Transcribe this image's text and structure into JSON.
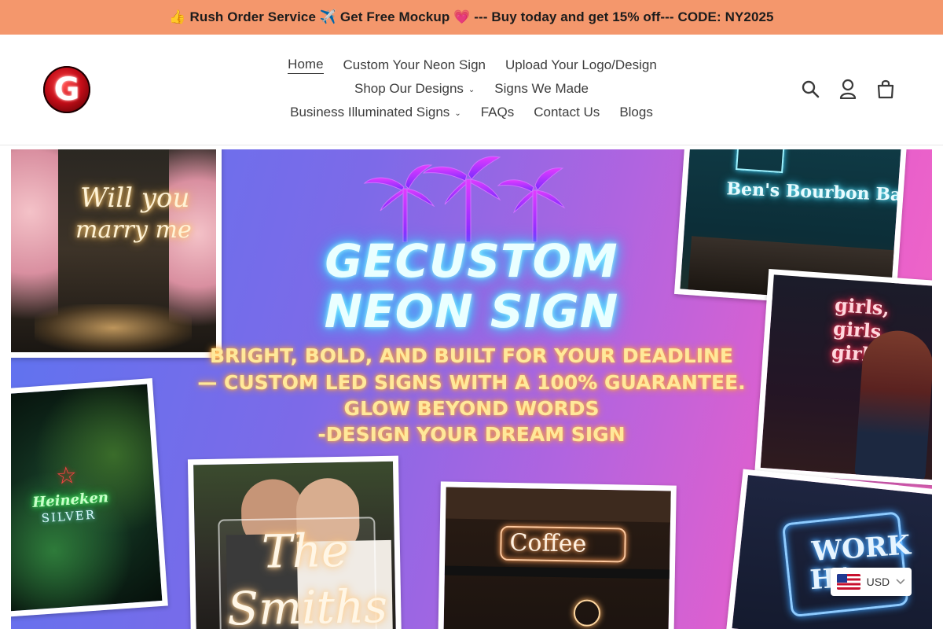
{
  "announcement": {
    "text": "👍 Rush Order Service ✈️ Get Free Mockup 💗 --- Buy today and get 15% off--- CODE: NY2025"
  },
  "header": {
    "logo_letter": "G",
    "nav": {
      "row1": [
        {
          "label": "Home",
          "active": true
        },
        {
          "label": "Custom Your Neon Sign"
        },
        {
          "label": "Upload Your Logo/Design"
        }
      ],
      "row2": [
        {
          "label": "Shop Our Designs",
          "dropdown": true
        },
        {
          "label": "Signs We Made"
        }
      ],
      "row3": [
        {
          "label": "Business Illuminated Signs",
          "dropdown": true
        },
        {
          "label": "FAQs"
        },
        {
          "label": "Contact Us"
        },
        {
          "label": "Blogs"
        }
      ]
    },
    "icons": [
      "search-icon",
      "account-icon",
      "cart-icon"
    ]
  },
  "hero": {
    "title_line1": "GECUSTOM",
    "title_line2": "NEON SIGN",
    "lines": [
      "BRIGHT, BOLD, AND BUILT FOR YOUR DEADLINE",
      "— CUSTOM LED SIGNS WITH A 100% GUARANTEE.",
      "GLOW BEYOND WORDS",
      "-DESIGN YOUR DREAM SIGN"
    ],
    "photos": {
      "proposal": {
        "line1": "Will you",
        "line2": "marry me"
      },
      "bar": {
        "text": "Ben's Bourbon Bar"
      },
      "girls": {
        "line1": "girls,",
        "line2": "girls,",
        "line3": "girls"
      },
      "beer": {
        "line1": "Heineken",
        "line2": "SILVER"
      },
      "wedding": {
        "line1": "The",
        "line2": "Smiths"
      },
      "coffee": {
        "text": "Coffee"
      },
      "work": {
        "line1": "WORK",
        "line2": "HA"
      }
    }
  },
  "currency": {
    "code": "USD"
  },
  "colors": {
    "announcement_bg": "#f4976c",
    "neon_cyan": "#46d9ff",
    "neon_yellow": "#ffe89a"
  }
}
